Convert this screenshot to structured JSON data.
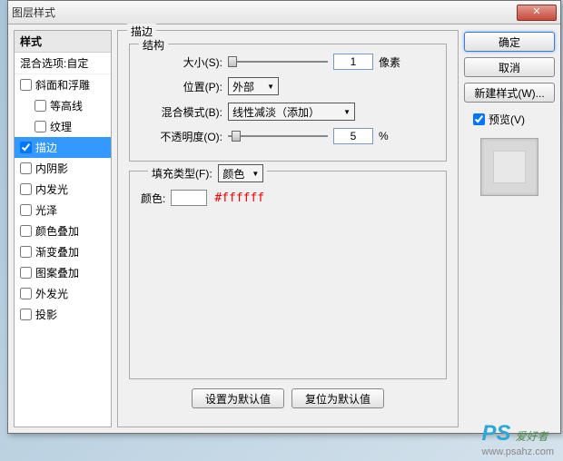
{
  "dialog": {
    "title": "图层样式",
    "close": "✕"
  },
  "left": {
    "header": "样式",
    "sub": "混合选项:自定",
    "items": [
      {
        "label": "斜面和浮雕",
        "checked": false,
        "indent": false
      },
      {
        "label": "等高线",
        "checked": false,
        "indent": true
      },
      {
        "label": "纹理",
        "checked": false,
        "indent": true
      },
      {
        "label": "描边",
        "checked": true,
        "indent": false,
        "selected": true
      },
      {
        "label": "内阴影",
        "checked": false,
        "indent": false
      },
      {
        "label": "内发光",
        "checked": false,
        "indent": false
      },
      {
        "label": "光泽",
        "checked": false,
        "indent": false
      },
      {
        "label": "颜色叠加",
        "checked": false,
        "indent": false
      },
      {
        "label": "渐变叠加",
        "checked": false,
        "indent": false
      },
      {
        "label": "图案叠加",
        "checked": false,
        "indent": false
      },
      {
        "label": "外发光",
        "checked": false,
        "indent": false
      },
      {
        "label": "投影",
        "checked": false,
        "indent": false
      }
    ]
  },
  "middle": {
    "groupTitle": "描边",
    "structTitle": "结构",
    "size": {
      "label": "大小(S):",
      "value": "1",
      "unit": "像素"
    },
    "position": {
      "label": "位置(P):",
      "value": "外部"
    },
    "blend": {
      "label": "混合模式(B):",
      "value": "线性减淡（添加）"
    },
    "opacity": {
      "label": "不透明度(O):",
      "value": "5",
      "unit": "%"
    },
    "fillType": {
      "label": "填充类型(F):",
      "value": "颜色"
    },
    "color": {
      "label": "颜色:",
      "hex": "#ffffff"
    },
    "btnDefault": "设置为默认值",
    "btnReset": "复位为默认值"
  },
  "right": {
    "ok": "确定",
    "cancel": "取消",
    "newStyle": "新建样式(W)...",
    "preview": "预览(V)"
  },
  "watermark": {
    "ps": "PS",
    "text": "爱好者",
    "url": "www.psahz.com"
  }
}
